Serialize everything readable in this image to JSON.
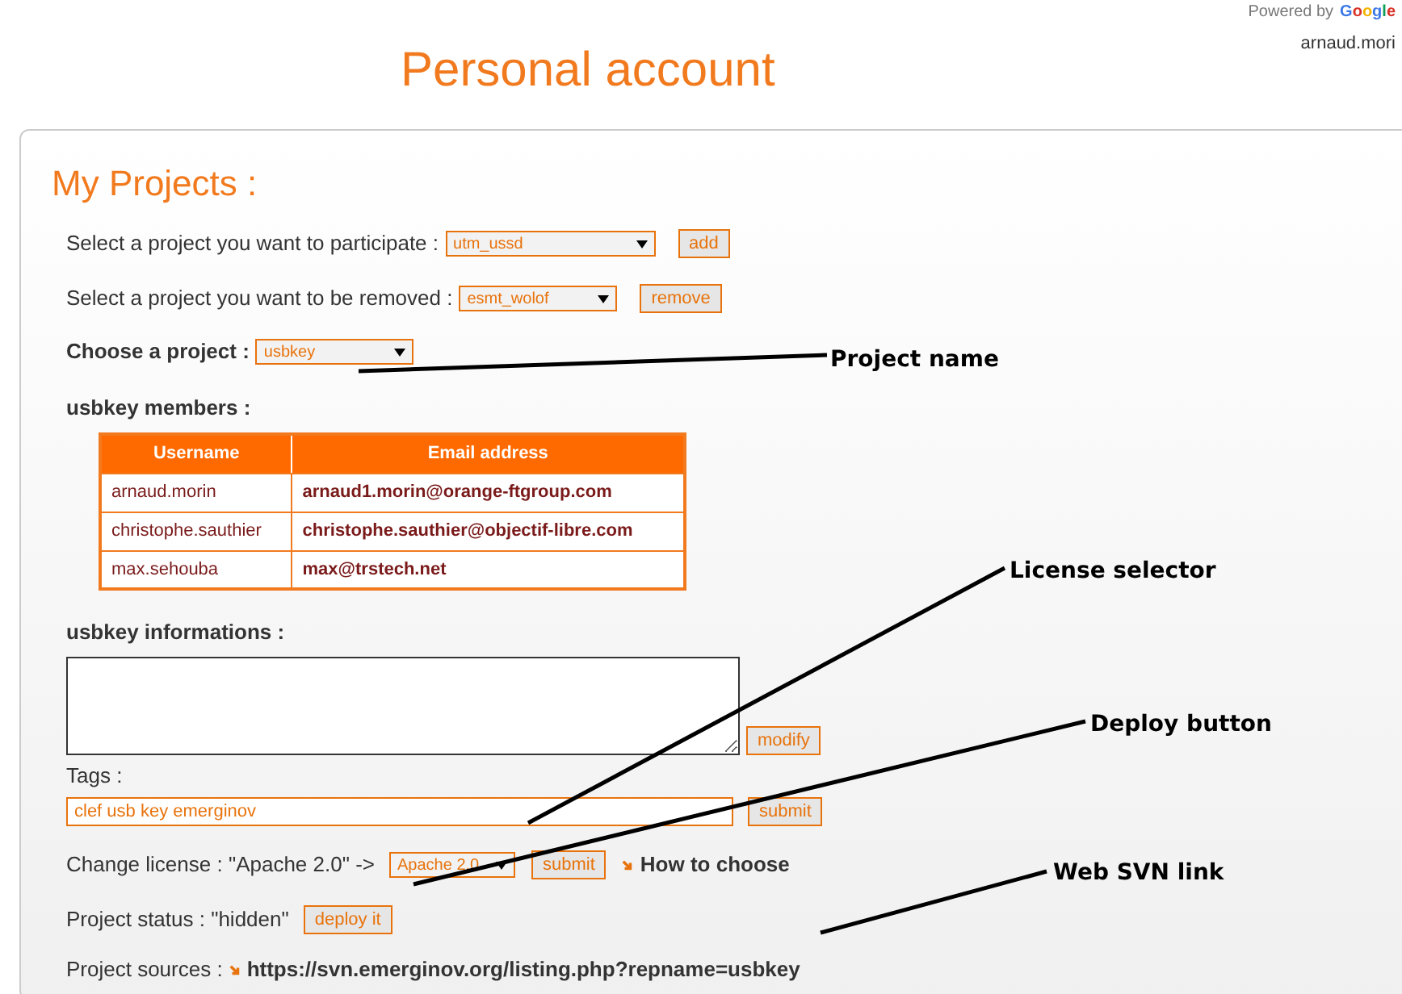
{
  "header": {
    "title": "Personal account",
    "powered_by": "Powered by",
    "google": "Google",
    "user": "arnaud.mori"
  },
  "panel": {
    "title": "My Projects :",
    "participate": {
      "label": "Select a project you want to participate :",
      "value": "utm_ussd",
      "button": "add"
    },
    "remove": {
      "label": "Select a project you want to be removed :",
      "value": "esmt_wolof",
      "button": "remove"
    },
    "choose": {
      "label": "Choose a project :",
      "value": "usbkey"
    },
    "members": {
      "heading": "usbkey members :",
      "columns": [
        "Username",
        "Email address"
      ],
      "rows": [
        [
          "arnaud.morin",
          "arnaud1.morin@orange-ftgroup.com"
        ],
        [
          "christophe.sauthier",
          "christophe.sauthier@objectif-libre.com"
        ],
        [
          "max.sehouba",
          "max@trstech.net"
        ]
      ]
    },
    "informations": {
      "heading": "usbkey informations :",
      "button": "modify"
    },
    "tags": {
      "label": "Tags :",
      "value": "clef usb key emerginov",
      "button": "submit"
    },
    "license": {
      "label": "Change license : \"Apache 2.0\" ->",
      "value": "Apache 2.0",
      "button": "submit",
      "link": "How to choose"
    },
    "status": {
      "label": "Project status : \"hidden\"",
      "button": "deploy it"
    },
    "sources": {
      "label": "Project sources :",
      "link": "https://svn.emerginov.org/listing.php?repname=usbkey"
    }
  },
  "annotations": [
    {
      "text": "Project name"
    },
    {
      "text": "License selector"
    },
    {
      "text": "Deploy button"
    },
    {
      "text": "Web SVN link"
    }
  ]
}
